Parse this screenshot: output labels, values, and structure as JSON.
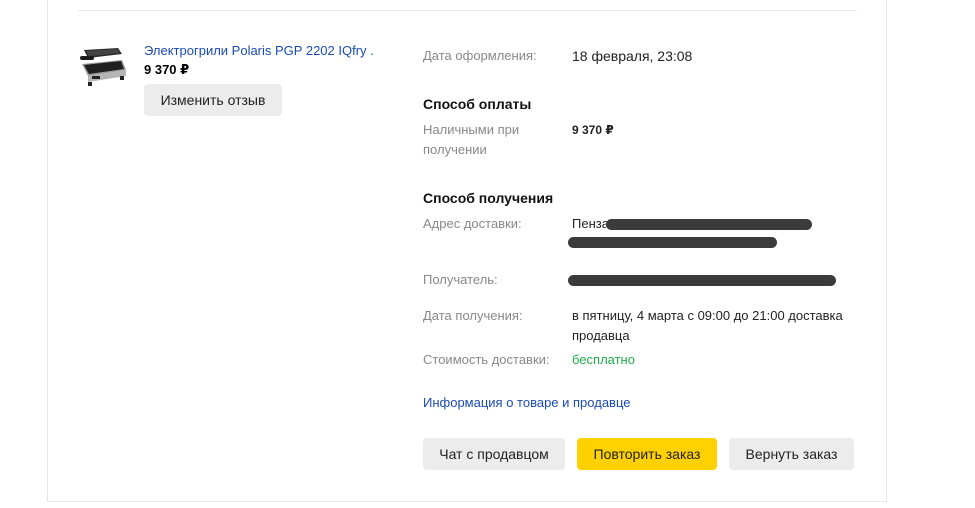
{
  "product": {
    "title": "Электрогрили Polaris PGP 2202 IQfry .",
    "price": "9 370 ₽",
    "review_button": "Изменить отзыв"
  },
  "order": {
    "date_label": "Дата оформления:",
    "date_value": "18 февраля, 23:08"
  },
  "payment": {
    "title": "Способ оплаты",
    "method_label": "Наличными при получении",
    "amount": "9 370 ₽"
  },
  "delivery": {
    "title": "Способ получения",
    "address_label": "Адрес доставки:",
    "address_value": "Пенза",
    "recipient_label": "Получатель:",
    "date_label": "Дата получения:",
    "date_value": "в пятницу, 4 марта с 09:00 до 21:00 доставка продавца",
    "cost_label": "Стоимость доставки:",
    "cost_value": "бесплатно"
  },
  "links": {
    "info": "Информация о товаре и продавце"
  },
  "actions": {
    "chat": "Чат с продавцом",
    "repeat": "Повторить заказ",
    "return": "Вернуть заказ"
  },
  "colors": {
    "link": "#1a4bb3",
    "primary_button": "#ffd100",
    "secondary_button": "#ececec",
    "free_text": "#1fad4c"
  }
}
